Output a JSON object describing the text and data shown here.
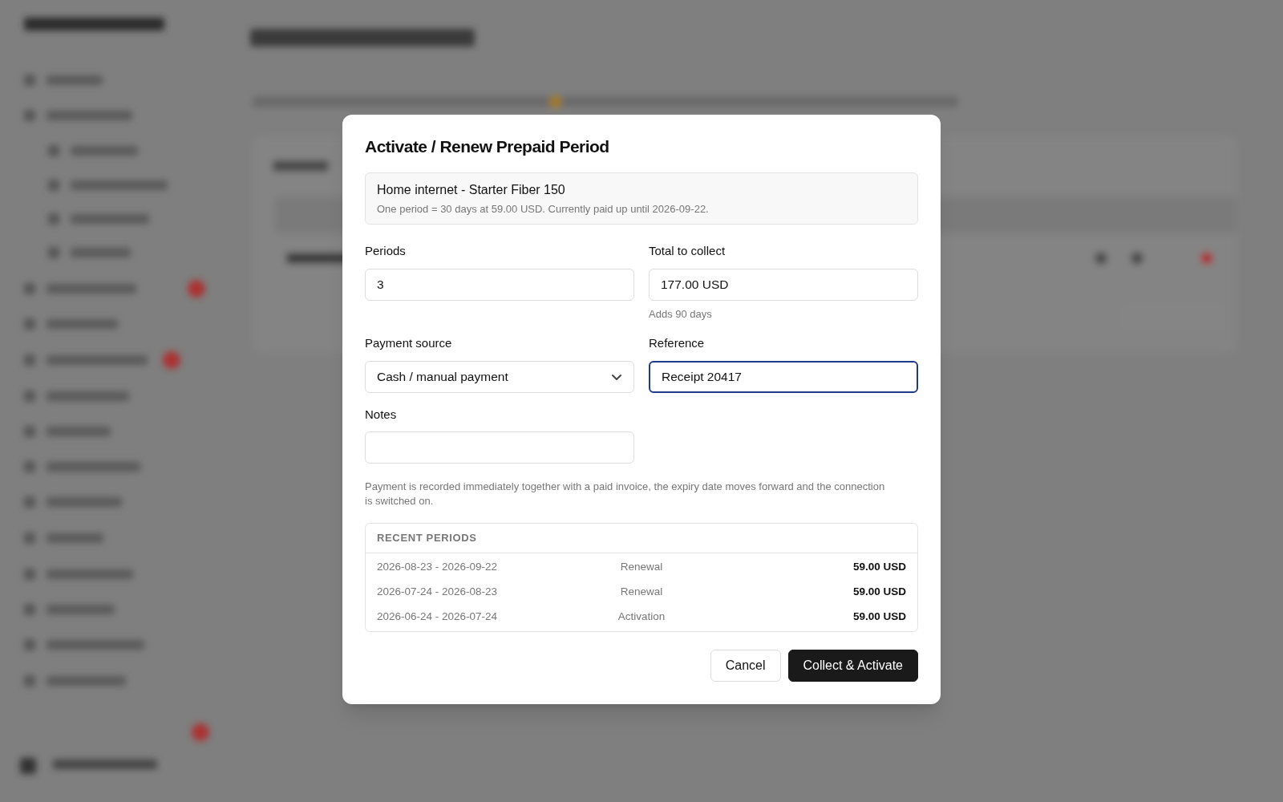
{
  "dialog": {
    "title": "Activate / Renew Prepaid Period",
    "service": {
      "name": "Home internet - Starter Fiber 150",
      "description": "One period = 30 days at 59.00 USD. Currently paid up until 2026-09-22."
    },
    "fields": [
      {
        "label": "Periods",
        "kind": "input",
        "value": "3",
        "focused": false
      },
      {
        "label": "Total to collect",
        "kind": "input",
        "value": "177.00 USD",
        "hint": "Adds 90 days",
        "focused": false
      },
      {
        "label": "Payment source",
        "kind": "select",
        "value": "Cash / manual payment",
        "focused": false
      },
      {
        "label": "Reference",
        "kind": "input",
        "value": "Receipt 20417",
        "focused": true
      },
      {
        "label": "Notes",
        "kind": "input",
        "focused": false
      }
    ],
    "note": "Payment is recorded immediately together with a paid invoice, the expiry date moves forward and the connection is switched on.",
    "recent_periods": {
      "heading": "RECENT PERIODS",
      "rows": [
        {
          "range": "2026-08-23 - 2026-09-22",
          "type": "Renewal",
          "amount": "59.00 USD"
        },
        {
          "range": "2026-07-24 - 2026-08-23",
          "type": "Renewal",
          "amount": "59.00 USD"
        },
        {
          "range": "2026-06-24 - 2026-07-24",
          "type": "Activation",
          "amount": "59.00 USD"
        }
      ]
    },
    "buttons": [
      {
        "label": "Cancel",
        "kind": "secondary"
      },
      {
        "label": "Collect & Activate",
        "kind": "primary"
      }
    ]
  }
}
